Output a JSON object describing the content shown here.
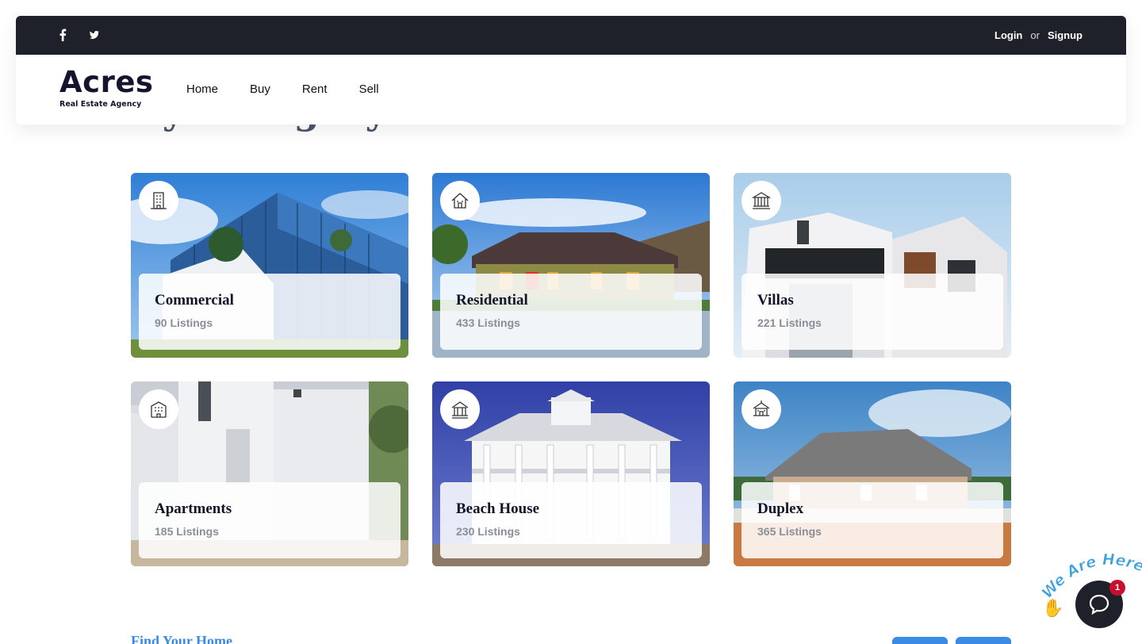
{
  "header": {
    "social": [
      {
        "icon": "facebook-icon",
        "label": "f"
      },
      {
        "icon": "twitter-icon",
        "label": "twitter"
      }
    ],
    "auth": {
      "login": "Login",
      "or": "or",
      "signup": "Signup"
    },
    "logo": {
      "name": "Acres",
      "tagline": "Real Estate Agency"
    },
    "nav": [
      "Home",
      "Buy",
      "Rent",
      "Sell"
    ]
  },
  "section": {
    "heading": "By Category"
  },
  "categories": [
    {
      "title": "Commercial",
      "count": "90 Listings",
      "icon": "office-building-icon"
    },
    {
      "title": "Residential",
      "count": "433 Listings",
      "icon": "house-icon"
    },
    {
      "title": "Villas",
      "count": "221 Listings",
      "icon": "columns-building-icon"
    },
    {
      "title": "Apartments",
      "count": "185 Listings",
      "icon": "apartment-icon"
    },
    {
      "title": "Beach House",
      "count": "230 Listings",
      "icon": "beach-house-icon"
    },
    {
      "title": "Duplex",
      "count": "365 Listings",
      "icon": "duplex-icon"
    }
  ],
  "footer_section": {
    "title": "Find Your Home"
  },
  "chat": {
    "label": "We Are Here!",
    "unread": "1"
  },
  "colors": {
    "dark": "#1e2129",
    "accent": "#3a8be6",
    "badge": "#c8102e"
  }
}
